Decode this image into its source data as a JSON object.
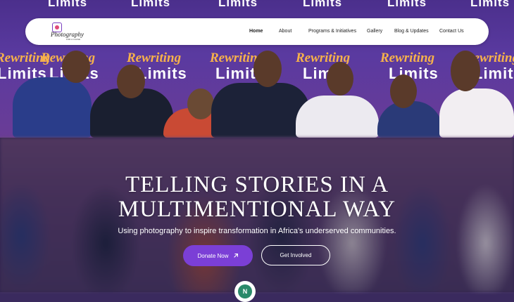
{
  "nav": {
    "logo_text": "Photography",
    "logo_sub": "FOR A CAUSE",
    "items": [
      {
        "label": "Home",
        "active": true
      },
      {
        "label": "About"
      },
      {
        "label": "Programs & Initiatives"
      },
      {
        "label": "Gallery"
      },
      {
        "label": "Blog & Updates"
      },
      {
        "label": "Contact Us"
      }
    ]
  },
  "banner": {
    "word1": "Rewriting",
    "word2": "Limits"
  },
  "hero": {
    "headline_line1": "TELLING STORIES IN A",
    "headline_line2": "MULTIMENTIONAL WAY",
    "subtitle": "Using photography to inspire transformation in Africa's underserved communities.",
    "primary_button": "Donate Now",
    "primary_icon": "arrow-up-right-icon",
    "secondary_button": "Get Involved"
  },
  "chat_badge": {
    "letter": "N"
  },
  "colors": {
    "accent": "#7b3fd6",
    "banner_purple": "#5a3aa0",
    "banner_orange": "#f7b24a"
  }
}
